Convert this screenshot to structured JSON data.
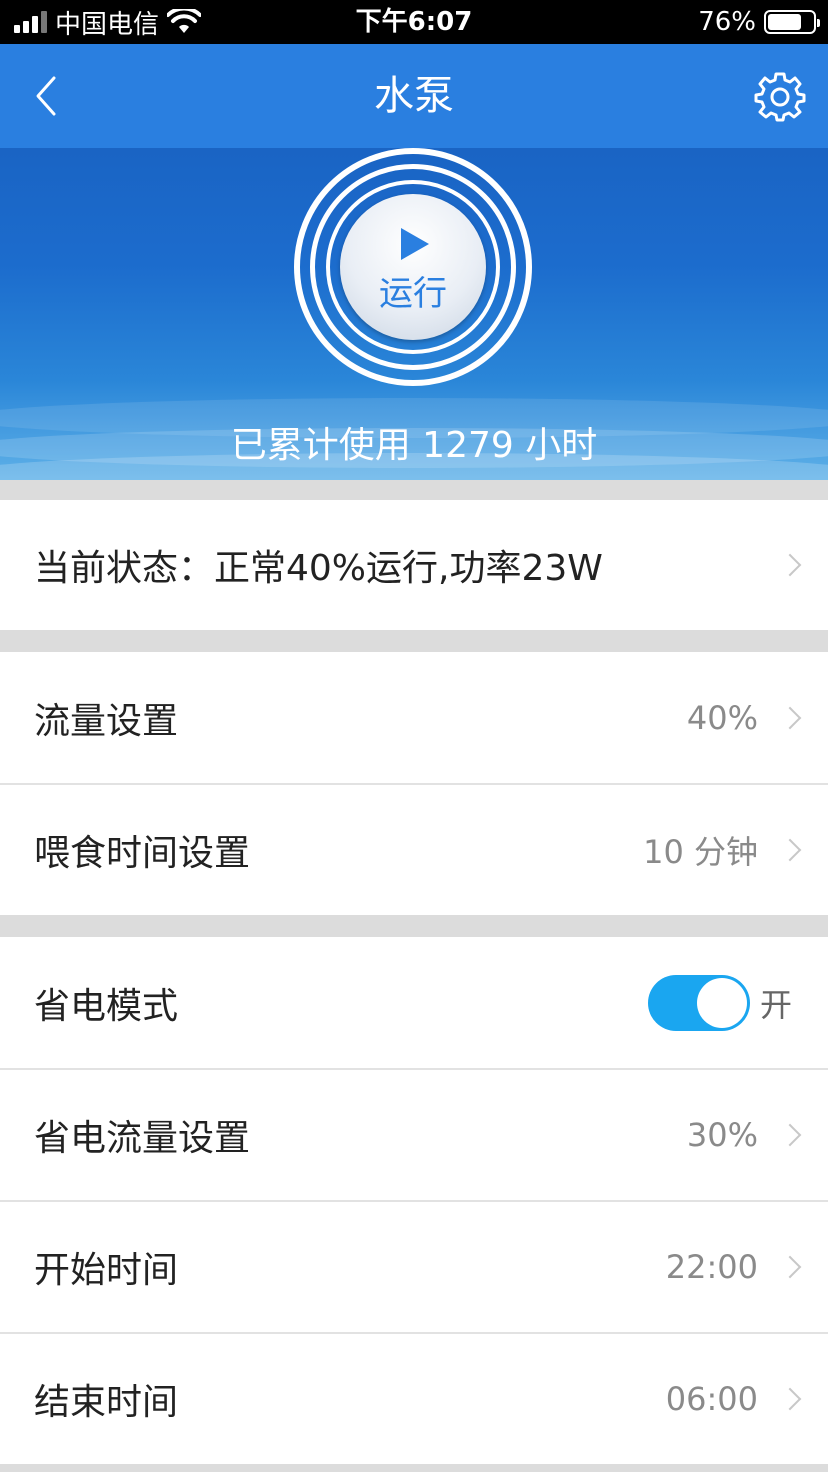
{
  "status_bar": {
    "carrier": "中国电信",
    "time": "下午6:07",
    "battery_percent": "76%",
    "battery_level": 0.76
  },
  "nav": {
    "title": "水泵",
    "back_icon": "chevron-left-icon",
    "settings_icon": "gear-icon"
  },
  "hero": {
    "run_label": "运行",
    "usage_text": "已累计使用 1279 小时"
  },
  "status": {
    "text": "当前状态：正常40%运行,功率23W"
  },
  "settings": {
    "flow": {
      "label": "流量设置",
      "value": "40%"
    },
    "feed_time": {
      "label": "喂食时间设置",
      "value": "10 分钟"
    }
  },
  "power_saving": {
    "mode": {
      "label": "省电模式",
      "toggle_text": "开",
      "enabled": true
    },
    "flow": {
      "label": "省电流量设置",
      "value": "30%"
    },
    "start_time": {
      "label": "开始时间",
      "value": "22:00"
    },
    "end_time": {
      "label": "结束时间",
      "value": "06:00"
    }
  },
  "colors": {
    "nav_blue": "#2a7fe0",
    "toggle_on": "#1aa6f0"
  }
}
